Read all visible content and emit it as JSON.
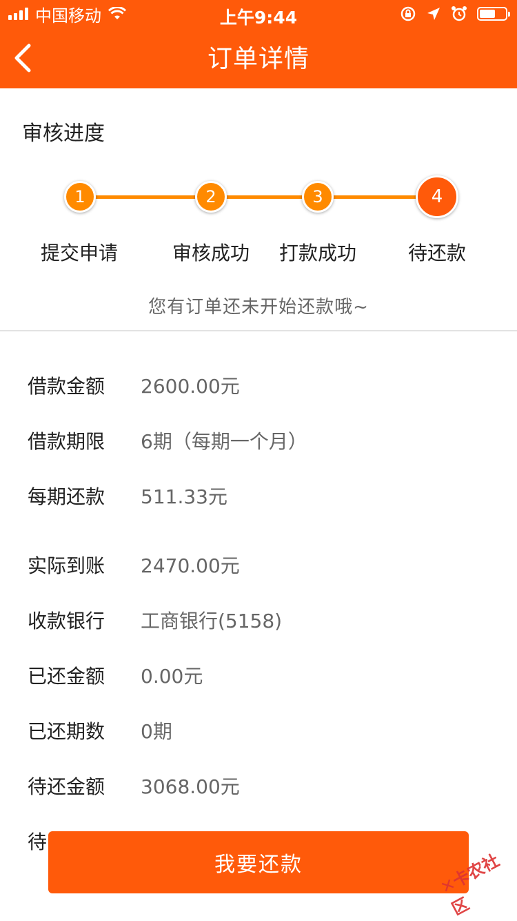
{
  "status_bar": {
    "carrier": "中国移动",
    "time": "上午9:44"
  },
  "nav": {
    "title": "订单详情"
  },
  "progress": {
    "title": "审核进度",
    "steps": [
      {
        "number": "1",
        "label": "提交申请"
      },
      {
        "number": "2",
        "label": "审核成功"
      },
      {
        "number": "3",
        "label": "打款成功"
      },
      {
        "number": "4",
        "label": "待还款"
      }
    ],
    "notice": "您有订单还未开始还款哦~"
  },
  "details": [
    {
      "label": "借款金额",
      "value": "2600.00元"
    },
    {
      "label": "借款期限",
      "value": "6期（每期一个月）"
    },
    {
      "label": "每期还款",
      "value": "511.33元"
    },
    {
      "label": "实际到账",
      "value": "2470.00元"
    },
    {
      "label": "收款银行",
      "value": "工商银行(5158)"
    },
    {
      "label": "已还金额",
      "value": "0.00元"
    },
    {
      "label": "已还期数",
      "value": "0期"
    },
    {
      "label": "待还金额",
      "value": "3068.00元"
    },
    {
      "label": "待",
      "value": ""
    }
  ],
  "repay_button": {
    "label": "我要还款"
  },
  "watermark": {
    "text": "卡农社区"
  },
  "colors": {
    "brand": "#ff5a0a",
    "step": "#ff8a00"
  }
}
